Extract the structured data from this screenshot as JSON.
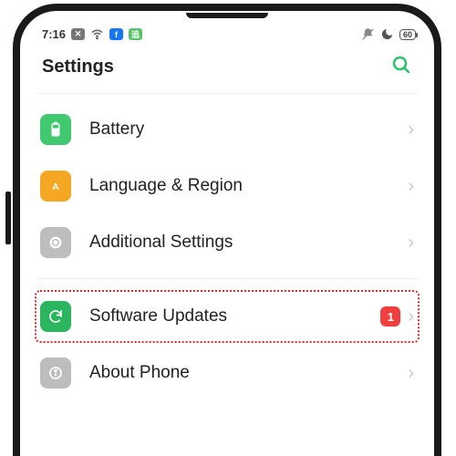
{
  "status_bar": {
    "time": "7:16",
    "battery_pct": "60"
  },
  "header": {
    "title": "Settings"
  },
  "items": {
    "battery": {
      "label": "Battery"
    },
    "language": {
      "label": "Language & Region"
    },
    "additional": {
      "label": "Additional Settings"
    },
    "software_updates": {
      "label": "Software Updates",
      "badge": "1"
    },
    "about_phone": {
      "label": "About Phone"
    }
  }
}
